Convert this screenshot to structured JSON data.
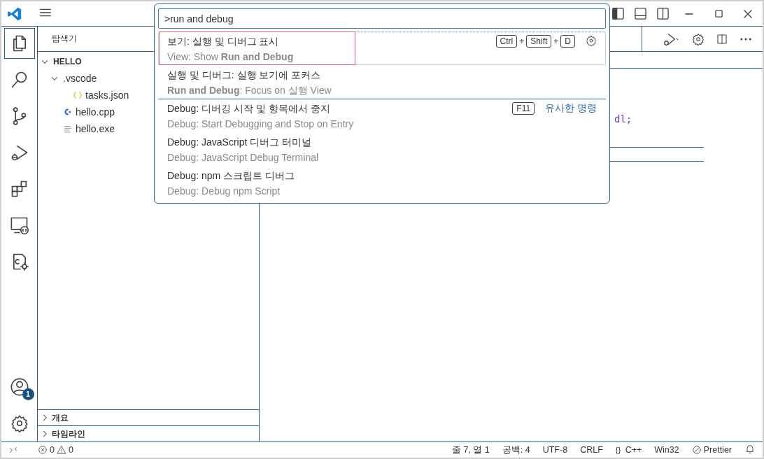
{
  "activity_bar": {
    "items": [
      {
        "kind": "files",
        "selected": true
      },
      {
        "kind": "search",
        "selected": false
      },
      {
        "kind": "branch",
        "selected": false
      },
      {
        "kind": "run",
        "selected": false
      },
      {
        "kind": "extensions",
        "selected": false
      },
      {
        "kind": "remote",
        "selected": false
      },
      {
        "kind": "cgear",
        "selected": false
      }
    ],
    "account_badge": "1"
  },
  "sidebar": {
    "title": "탐색기",
    "tree": [
      {
        "label": "HELLO",
        "kind": "root",
        "expanded": true,
        "children": [
          {
            "label": ".vscode",
            "kind": "folder",
            "expanded": true,
            "children": [
              {
                "label": "tasks.json",
                "kind": "json"
              }
            ]
          },
          {
            "label": "hello.cpp",
            "kind": "cpp"
          },
          {
            "label": "hello.exe",
            "kind": "file"
          }
        ]
      }
    ],
    "sections": [
      {
        "label": "개요",
        "expanded": false
      },
      {
        "label": "타임라인",
        "expanded": false
      }
    ]
  },
  "editor": {
    "code_fragment": "dl;"
  },
  "command_palette": {
    "value": ">run and debug",
    "items": [
      {
        "label": "보기: 실행 및 디버그 표시",
        "detail": "View: Show **Run and Debug**",
        "selected": true,
        "separator": false,
        "keybinding": [
          {
            "kind": "key",
            "text": "Ctrl"
          },
          {
            "kind": "plus",
            "text": "+"
          },
          {
            "kind": "key",
            "text": "Shift"
          },
          {
            "kind": "plus",
            "text": "+"
          },
          {
            "kind": "key",
            "text": "D"
          }
        ],
        "gear": true
      },
      {
        "label": "실행 및 디버그: 실행 보기에 포커스",
        "detail": "**Run and Debug**: Focus on 실행 View",
        "selected": false,
        "separator": false,
        "gear": false
      },
      {
        "label": "Debug: 디버깅 시작 및 항목에서 중지",
        "detail": "Debug: Start Debugging and Stop on Entry",
        "selected": false,
        "separator": true,
        "keybinding": [
          {
            "kind": "key",
            "text": "F11"
          }
        ],
        "group_label": "유사한 명령",
        "gear": false
      },
      {
        "label": "Debug: JavaScript 디버그 터미널",
        "detail": "Debug: JavaScript Debug Terminal",
        "selected": false,
        "separator": false,
        "gear": false
      },
      {
        "label": "Debug: npm 스크립트 디버그",
        "detail": "Debug: Debug npm Script",
        "selected": false,
        "separator": false,
        "gear": false
      }
    ]
  },
  "status_bar": {
    "errors": "0",
    "warnings": "0",
    "right": [
      {
        "kind": "text",
        "text": "줄 7, 열 1"
      },
      {
        "kind": "text",
        "text": "공백: 4"
      },
      {
        "kind": "text",
        "text": "UTF-8"
      },
      {
        "kind": "text",
        "text": "CRLF"
      },
      {
        "kind": "language",
        "icon": "{}",
        "text": "C++"
      },
      {
        "kind": "text",
        "text": "Win32"
      },
      {
        "kind": "prettier",
        "text": "Prettier"
      }
    ]
  }
}
